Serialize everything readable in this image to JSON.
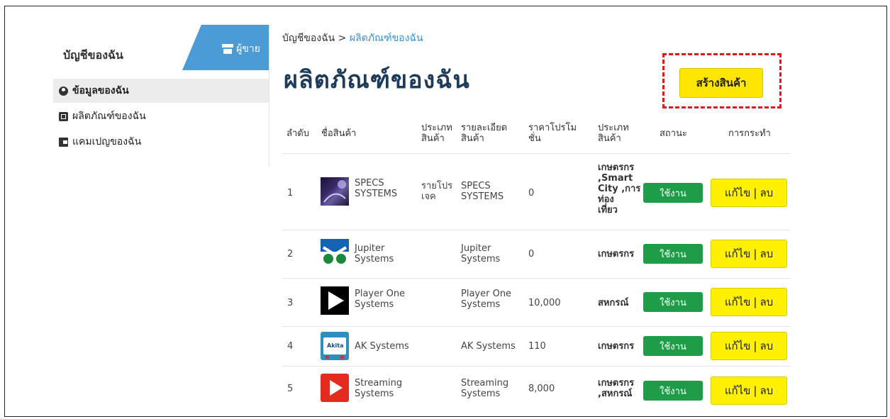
{
  "sidebar": {
    "title": "บัญชีของฉัน",
    "seller_tab": "ผู้ขาย",
    "items": [
      {
        "label": "ข้อมูลของฉัน"
      },
      {
        "label": "ผลิตภัณฑ์ของฉัน"
      },
      {
        "label": "แคมเปญของฉัน"
      }
    ]
  },
  "breadcrumb": {
    "root": "บัญชีของฉัน",
    "sep": ">",
    "current": "ผลิตภัณฑ์ของฉัน"
  },
  "page_title": "ผลิตภัณฑ์ของฉัน",
  "create_button": "สร้างสินค้า",
  "table": {
    "headers": {
      "no": "ลำดับ",
      "name": "ชื่อสินค้า",
      "type": "ประเภท\nสินค้า",
      "detail": "รายละเอียด\nสินค้า",
      "promo": "ราคาโปรโม\nชั่น",
      "category": "ประเภท\nสินค้า",
      "status": "สถานะ",
      "action": "การกระทำ"
    },
    "rows": [
      {
        "no": "1",
        "name": "SPECS\nSYSTEMS",
        "type": "รายโปร\nเจค",
        "detail": "SPECS\nSYSTEMS",
        "price": "0",
        "category": "เกษตรกร\n,Smart\nCity ,การ\nท่อง\nเที่ยว",
        "status": "ใช้งาน",
        "edit": "แก้ไข",
        "sep": "|",
        "del": "ลบ",
        "thumb": "space"
      },
      {
        "no": "2",
        "name": "Jupiter\nSystems",
        "type": "",
        "detail": "Jupiter\nSystems",
        "price": "0",
        "category": "เกษตรกร",
        "status": "ใช้งาน",
        "edit": "แก้ไข",
        "sep": "|",
        "del": "ลบ",
        "thumb": "jupiter"
      },
      {
        "no": "3",
        "name": "Player One\nSystems",
        "type": "",
        "detail": "Player One\nSystems",
        "price": "10,000",
        "category": "สหกรณ์",
        "status": "ใช้งาน",
        "edit": "แก้ไข",
        "sep": "|",
        "del": "ลบ",
        "thumb": "play"
      },
      {
        "no": "4",
        "name": "AK Systems",
        "type": "",
        "detail": "AK Systems",
        "price": "110",
        "category": "เกษตรกร",
        "status": "ใช้งาน",
        "edit": "แก้ไข",
        "sep": "|",
        "del": "ลบ",
        "thumb": "akita"
      },
      {
        "no": "5",
        "name": "Streaming\nSystems",
        "type": "",
        "detail": "Streaming\nSystems",
        "price": "8,000",
        "category": "เกษตรกร\n,สหกรณ์",
        "status": "ใช้งาน",
        "edit": "แก้ไข",
        "sep": "|",
        "del": "ลบ",
        "thumb": "stream"
      }
    ]
  },
  "thumb_akita_text": "Akita",
  "colors": {
    "seller_tab": "#4a9bd6",
    "status_green": "#1e9c48",
    "action_yellow": "#fff100",
    "highlight_red": "#e01a1a",
    "title": "#1f3b5a"
  }
}
